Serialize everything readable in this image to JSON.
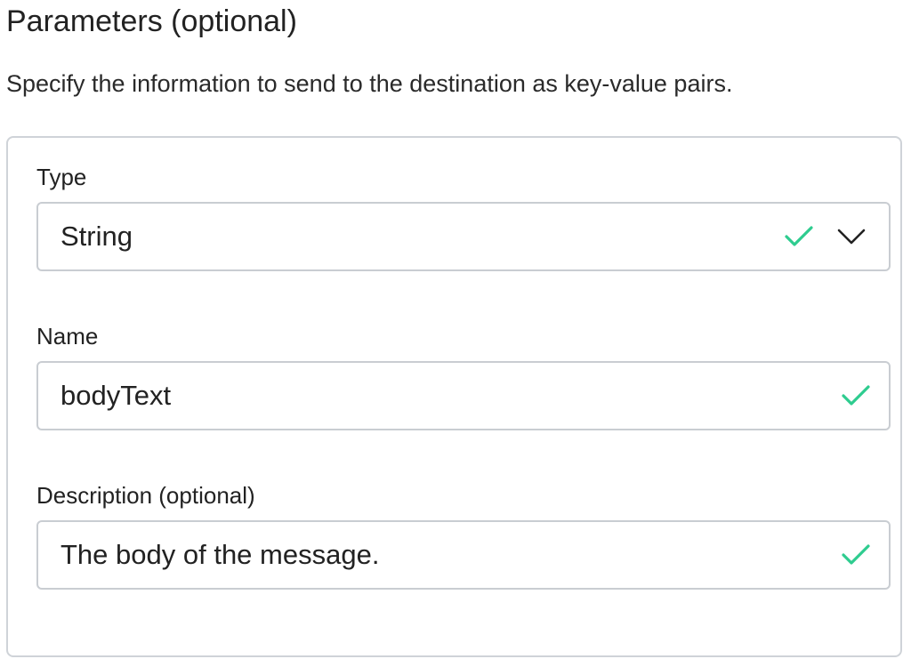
{
  "section": {
    "title": "Parameters (optional)",
    "description": "Specify the information to send to the destination as key-value pairs."
  },
  "fields": {
    "type": {
      "label": "Type",
      "value": "String",
      "valid": true,
      "icons": [
        "check-icon",
        "chevron-down-icon"
      ]
    },
    "name": {
      "label": "Name",
      "value": "bodyText",
      "valid": true,
      "icons": [
        "check-icon"
      ]
    },
    "description": {
      "label": "Description (optional)",
      "value": "The body of the message.",
      "valid": true,
      "icons": [
        "check-icon"
      ]
    }
  },
  "colors": {
    "valid_check": "#2ecc8f",
    "border": "#c9cdd2",
    "text": "#222222"
  }
}
